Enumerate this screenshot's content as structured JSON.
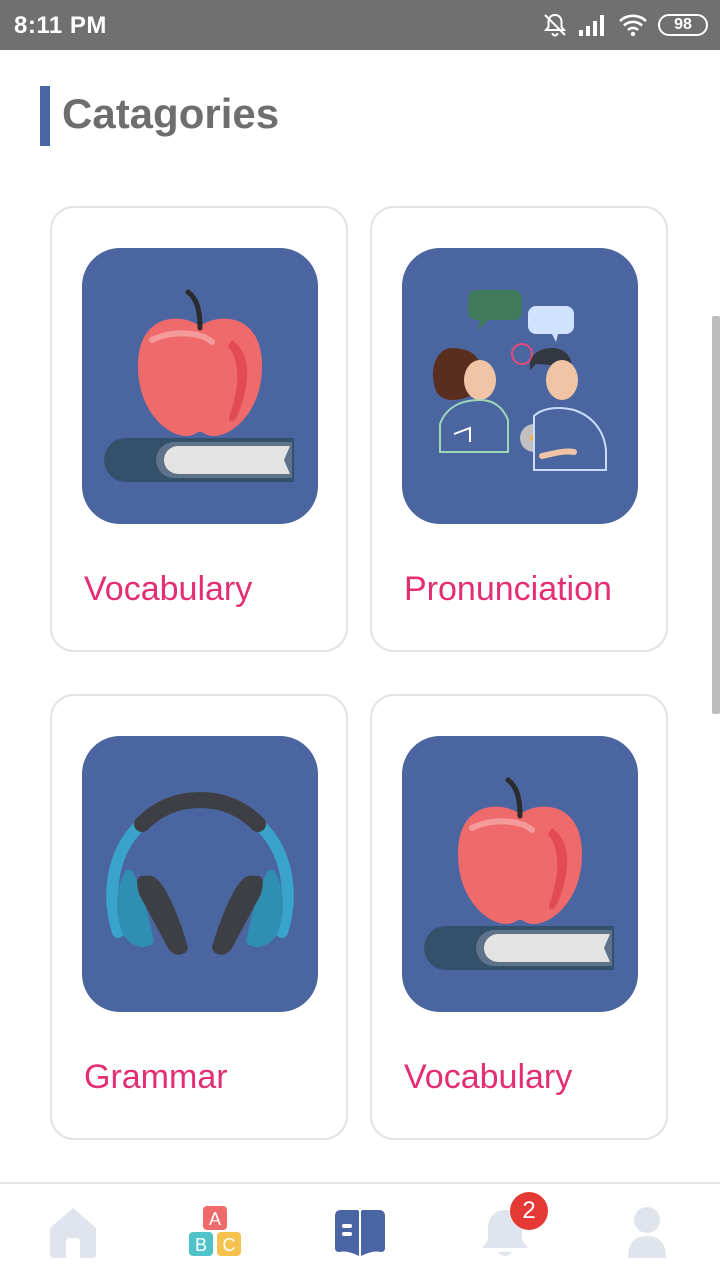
{
  "status_bar": {
    "time": "8:11 PM",
    "battery": "98",
    "icons": [
      "mute-bell-icon",
      "signal-icon",
      "wifi-icon",
      "battery-icon"
    ]
  },
  "header": {
    "title": "Catagories",
    "accent_color": "#4a65a4"
  },
  "categories": [
    {
      "label": "Vocabulary",
      "icon": "apple-book-icon"
    },
    {
      "label": "Pronunciation",
      "icon": "conversation-icon"
    },
    {
      "label": "Grammar",
      "icon": "headphones-icon"
    },
    {
      "label": "Vocabulary",
      "icon": "apple-book-icon"
    }
  ],
  "bottom_nav": {
    "items": [
      {
        "name": "home",
        "icon": "home-icon"
      },
      {
        "name": "abc",
        "icon": "abc-blocks-icon"
      },
      {
        "name": "book",
        "icon": "open-book-icon"
      },
      {
        "name": "notifications",
        "icon": "bell-icon"
      },
      {
        "name": "profile",
        "icon": "user-icon"
      }
    ],
    "notification_count": "2",
    "active_color": "#4a65a4"
  },
  "colors": {
    "label": "#e42e73",
    "card_thumb_bg": "#4a65a0"
  }
}
